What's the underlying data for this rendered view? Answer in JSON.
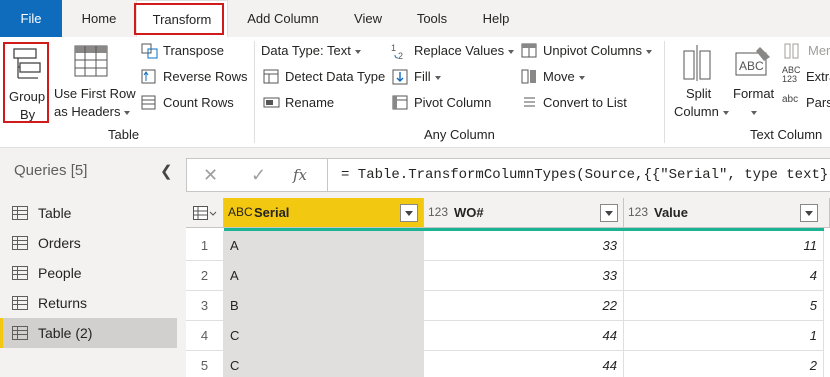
{
  "menu": {
    "tabs": [
      "File",
      "Home",
      "Transform",
      "Add Column",
      "View",
      "Tools",
      "Help"
    ]
  },
  "ribbon": {
    "table_group": {
      "label": "Table",
      "group_by": [
        "Group",
        "By"
      ],
      "first_row": [
        "Use First Row",
        "as Headers"
      ],
      "transpose": "Transpose",
      "reverse_rows": "Reverse Rows",
      "count_rows": "Count Rows"
    },
    "any_column_group": {
      "label": "Any Column",
      "data_type": "Data Type: Text",
      "detect_type": "Detect Data Type",
      "rename": "Rename",
      "replace_values": "Replace Values",
      "fill": "Fill",
      "pivot_column": "Pivot Column",
      "unpivot_columns": "Unpivot Columns",
      "move": "Move",
      "convert_to_list": "Convert to List"
    },
    "text_column_group": {
      "label": "Text Column",
      "split_column": [
        "Split",
        "Column"
      ],
      "format": "Format",
      "merge": "Mer",
      "extract": "Extra",
      "parse": "Pars"
    }
  },
  "queries": {
    "header": "Queries [5]",
    "items": [
      "Table",
      "Orders",
      "People",
      "Returns",
      "Table (2)"
    ]
  },
  "formula": {
    "text": "= Table.TransformColumnTypes(Source,{{\"Serial\", type text},",
    "fx": "fx"
  },
  "grid": {
    "columns": [
      {
        "type_icon": "ABC",
        "name": "Serial"
      },
      {
        "type_icon": "123",
        "name": "WO#"
      },
      {
        "type_icon": "123",
        "name": "Value"
      }
    ],
    "rows": [
      {
        "n": "1",
        "serial": "A",
        "wo": "33",
        "value": "11"
      },
      {
        "n": "2",
        "serial": "A",
        "wo": "33",
        "value": "4"
      },
      {
        "n": "3",
        "serial": "B",
        "wo": "22",
        "value": "5"
      },
      {
        "n": "4",
        "serial": "C",
        "wo": "44",
        "value": "1"
      },
      {
        "n": "5",
        "serial": "C",
        "wo": "44",
        "value": "2"
      }
    ]
  },
  "colors": {
    "file_tab": "#0f6cbd",
    "highlight": "#d11a1a",
    "column_selected_header": "#f2c811",
    "quality_bar": "#1ab394"
  }
}
